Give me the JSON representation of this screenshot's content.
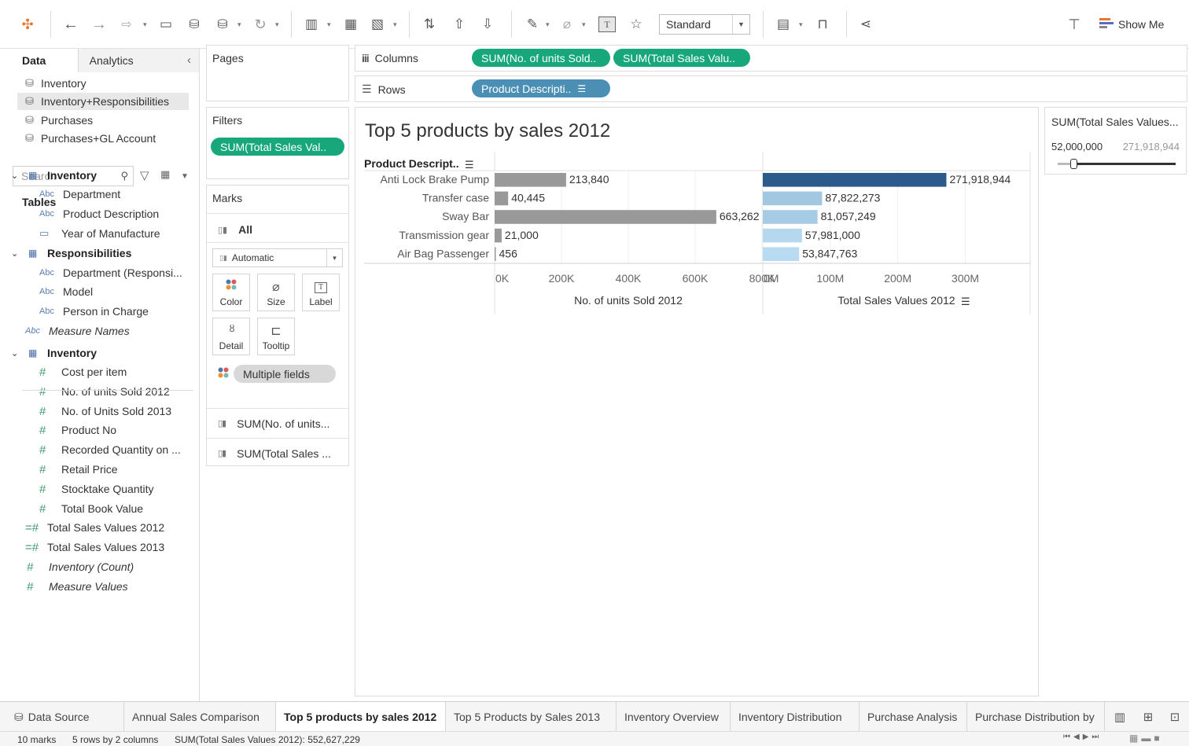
{
  "toolbar": {
    "view_size": "Standard",
    "show_me": "Show Me",
    "icons": [
      "tableau-logo-icon",
      "back-icon",
      "forward-icon",
      "redo-icon",
      "save-icon",
      "new-datasource-icon",
      "pause-icon",
      "refresh-icon",
      "new-worksheet-icon",
      "duplicate-icon",
      "clear-icon",
      "swap-icon",
      "sort-asc-icon",
      "sort-desc-icon",
      "highlight-icon",
      "group-icon",
      "label-icon",
      "pin-icon",
      "fit-icon",
      "presentation-icon",
      "share-icon",
      "tooltip-icon",
      "show-me-icon"
    ]
  },
  "data_pane": {
    "tab_data": "Data",
    "tab_analytics": "Analytics",
    "datasources": [
      "Inventory",
      "Inventory+Responsibilities",
      "Purchases",
      "Purchases+GL Account"
    ],
    "search_placeholder": "Search",
    "tables_heading": "Tables",
    "tree": [
      {
        "label": "Inventory",
        "kind": "table"
      },
      {
        "label": "Department",
        "kind": "abc"
      },
      {
        "label": "Product Description",
        "kind": "abc"
      },
      {
        "label": "Year of Manufacture",
        "kind": "date"
      },
      {
        "label": "Responsibilities",
        "kind": "table"
      },
      {
        "label": "Department (Responsi...",
        "kind": "abc"
      },
      {
        "label": "Model",
        "kind": "abc"
      },
      {
        "label": "Person in Charge",
        "kind": "abc"
      },
      {
        "label": "Measure Names",
        "kind": "abc-root"
      },
      {
        "label": "Inventory",
        "kind": "table"
      },
      {
        "label": "Cost per item",
        "kind": "measure"
      },
      {
        "label": "No. of units Sold 2012",
        "kind": "measure"
      },
      {
        "label": "No. of Units Sold 2013",
        "kind": "measure"
      },
      {
        "label": "Product No",
        "kind": "measure"
      },
      {
        "label": "Recorded Quantity on ...",
        "kind": "measure"
      },
      {
        "label": "Retail Price",
        "kind": "measure"
      },
      {
        "label": "Stocktake Quantity",
        "kind": "measure"
      },
      {
        "label": "Total Book Value",
        "kind": "measure"
      },
      {
        "label": "Total Sales Values 2012",
        "kind": "calc"
      },
      {
        "label": "Total Sales Values 2013",
        "kind": "calc"
      },
      {
        "label": "Inventory (Count)",
        "kind": "measure-root"
      },
      {
        "label": "Measure Values",
        "kind": "measure-root"
      }
    ]
  },
  "cards": {
    "pages": "Pages",
    "filters": "Filters",
    "filter_pill": "SUM(Total Sales Val..",
    "marks": "Marks",
    "marks_all": "All",
    "mark_type": "Automatic",
    "mark_buttons": [
      "Color",
      "Size",
      "Label",
      "Detail",
      "Tooltip"
    ],
    "multiple_fields": "Multiple fields",
    "measure_rows": [
      "SUM(No. of units...",
      "SUM(Total Sales ..."
    ]
  },
  "shelves": {
    "columns_label": "Columns",
    "columns_pills": [
      "SUM(No. of units Sold..",
      "SUM(Total Sales Valu.."
    ],
    "rows_label": "Rows",
    "rows_pill": "Product Descripti.."
  },
  "view": {
    "title": "Top 5 products by sales 2012"
  },
  "chart_data": {
    "type": "bar",
    "orientation": "horizontal",
    "title": "Top 5 products by sales 2012",
    "row_header": "Product Descript..",
    "categories": [
      "Anti Lock Brake Pump",
      "Transfer case",
      "Sway Bar",
      "Transmission gear",
      "Air Bag Passenger"
    ],
    "panes": [
      {
        "name": "No. of units Sold 2012",
        "xlabel": "No. of units Sold 2012",
        "values": [
          213840,
          40445,
          663262,
          21000,
          456
        ],
        "value_labels": [
          "213,840",
          "40,445",
          "663,262",
          "21,000",
          "456"
        ],
        "xlim": [
          0,
          800000
        ],
        "ticks": [
          0,
          200000,
          400000,
          600000,
          800000
        ],
        "tick_labels": [
          "0K",
          "200K",
          "400K",
          "600K",
          "800K"
        ],
        "color": "#999999"
      },
      {
        "name": "Total Sales Values 2012",
        "xlabel": "Total Sales Values 2012",
        "values": [
          271918944,
          87822273,
          81057249,
          57981000,
          53847763
        ],
        "value_labels": [
          "271,918,944",
          "87,822,273",
          "81,057,249",
          "57,981,000",
          "53,847,763"
        ],
        "xlim": [
          0,
          396000000
        ],
        "ticks": [
          0,
          100000000,
          200000000,
          300000000
        ],
        "tick_labels": [
          "0M",
          "100M",
          "200M",
          "300M"
        ],
        "color_scale": [
          "#b9dcf2",
          "#2c5a8a"
        ],
        "color_range": [
          52000000,
          271918944
        ]
      }
    ],
    "legend": "right"
  },
  "legend": {
    "title": "SUM(Total Sales Values...",
    "min_label": "52,000,000",
    "max_label": "271,918,944"
  },
  "sheet_tabs": {
    "data_source": "Data Source",
    "tabs": [
      "Annual Sales Comparison",
      "Top 5 products by sales 2012",
      "Top 5 Products by Sales 2013",
      "Inventory Overview",
      "Inventory Distribution",
      "Purchase Analysis",
      "Purchase Distribution by"
    ],
    "active_index": 1
  },
  "status": {
    "marks": "10 marks",
    "dims": "5 rows by 2 columns",
    "sum": "SUM(Total Sales Values 2012): 552,627,229"
  }
}
